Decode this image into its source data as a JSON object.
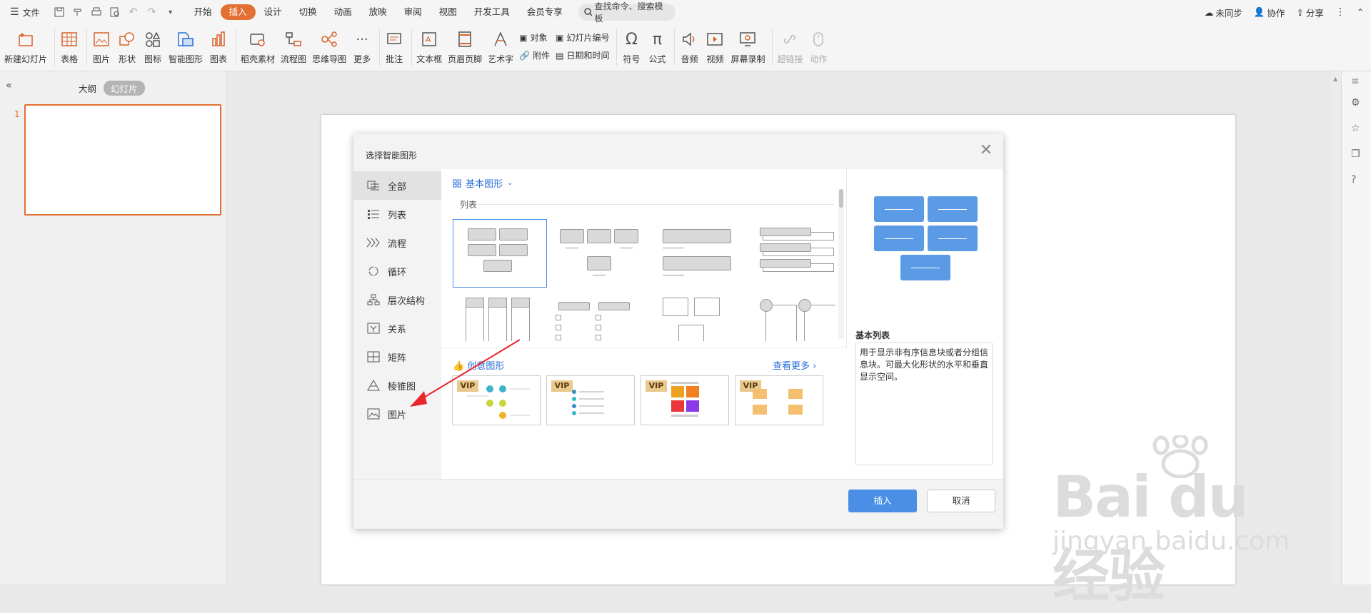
{
  "toolbar": {
    "file_label": "文件",
    "tabs": [
      "开始",
      "插入",
      "设计",
      "切换",
      "动画",
      "放映",
      "审阅",
      "视图",
      "开发工具",
      "会员专享"
    ],
    "search_placeholder": "查找命令、搜索模板",
    "sync": "未同步",
    "collab": "协作",
    "share": "分享"
  },
  "ribbon": {
    "new_slide": "新建幻灯片",
    "table": "表格",
    "picture": "图片",
    "shape": "形状",
    "icon": "图标",
    "smartart": "智能图形",
    "chart": "图表",
    "material": "稻壳素材",
    "flowchart": "流程图",
    "mindmap": "思维导图",
    "more": "更多",
    "comment": "批注",
    "textbox": "文本框",
    "header_footer": "页眉页脚",
    "wordart": "艺术字",
    "object": "对象",
    "attachment": "附件",
    "slide_number": "幻灯片编号",
    "datetime": "日期和时间",
    "symbol": "符号",
    "formula": "公式",
    "audio": "音频",
    "video": "视频",
    "screen_record": "屏幕录制",
    "hyperlink": "超链接",
    "action": "动作"
  },
  "left_panel": {
    "outline_tab": "大纲",
    "slides_tab": "幻灯片",
    "slide_number": "1"
  },
  "dialog": {
    "title": "选择智能图形",
    "categories": [
      "全部",
      "列表",
      "流程",
      "循环",
      "层次结构",
      "关系",
      "矩阵",
      "棱锥图",
      "图片"
    ],
    "section_title": "基本图形",
    "subsection_label": "列表",
    "creative_title": "创意图形",
    "see_more": "查看更多",
    "vip_label": "VIP",
    "preview_title": "基本列表",
    "preview_desc": "用于显示非有序信息块或者分组信息块。可最大化形状的水平和垂直显示空间。",
    "insert_button": "插入",
    "cancel_button": "取消"
  },
  "watermark": {
    "main": "Bai du 经验",
    "sub": "jingyan.baidu.com"
  },
  "colors": {
    "accent": "#e36f32",
    "primary": "#4a8ee6",
    "preview_block": "#5b9be6",
    "arrow": "#e8262c"
  }
}
